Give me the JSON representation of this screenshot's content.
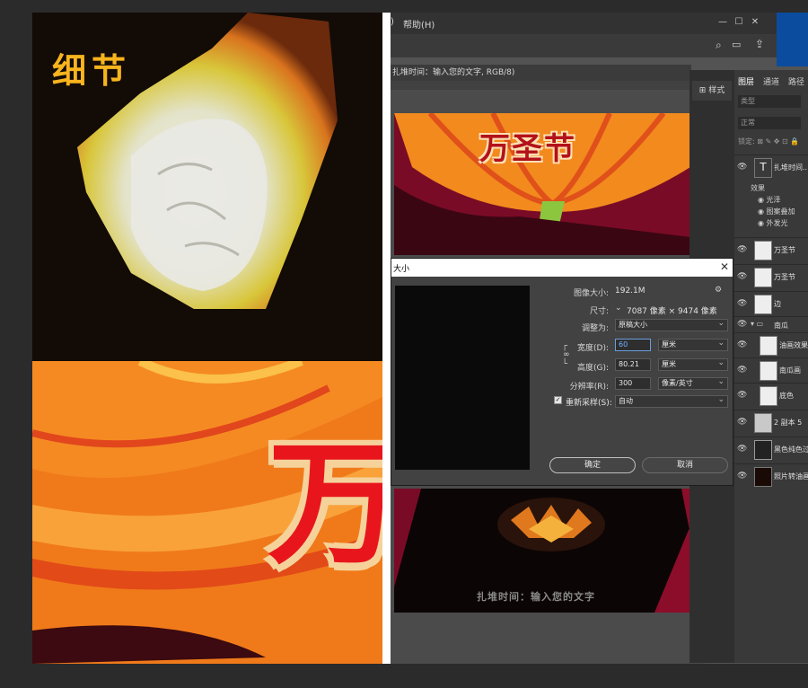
{
  "artwork": {
    "detail_title": "细节",
    "big_character": "万"
  },
  "menubar": {
    "prev_item_fragment": ")",
    "help": "帮助(H)"
  },
  "document": {
    "tab_title": "扎堆时间：输入您的文字, RGB/8)",
    "halloween_title": "万圣节",
    "footer_text": "扎堆时间：输入您的文字"
  },
  "style_panel": {
    "label": "样式"
  },
  "layers_panel": {
    "tabs": [
      "图层",
      "通道",
      "路径"
    ],
    "search_placeholder": "类型",
    "blend_mode": "正常",
    "lock_label": "锁定:",
    "layers": [
      {
        "name": "扎堆时间...",
        "type": "text"
      },
      {
        "name": "万圣节",
        "type": "pixel"
      },
      {
        "name": "万圣节",
        "type": "pixel"
      },
      {
        "name": "边",
        "type": "pixel"
      },
      {
        "name": "南瓜",
        "type": "group"
      },
      {
        "name": "油画效果",
        "type": "pixel"
      },
      {
        "name": "南瓜画",
        "type": "pixel"
      },
      {
        "name": "底色",
        "type": "pixel"
      },
      {
        "name": "2 副本 5",
        "type": "pixel"
      },
      {
        "name": "黑色纯色过滤",
        "type": "pixel"
      },
      {
        "name": "照片转油画效果",
        "type": "pixel"
      }
    ],
    "effects_label": "效果",
    "effects": [
      "光泽",
      "图案叠加",
      "外发光"
    ]
  },
  "dialog": {
    "title": "大小",
    "image_size_label": "图像大小:",
    "image_size_value": "192.1M",
    "dimensions_label": "尺寸:",
    "dimensions_value": "7087 像素 × 9474 像素",
    "fit_label": "调整为:",
    "fit_value": "原稿大小",
    "width_label": "宽度(D):",
    "width_value": "60",
    "width_unit": "厘米",
    "height_label": "高度(G):",
    "height_value": "80.21",
    "height_unit": "厘米",
    "resolution_label": "分辨率(R):",
    "resolution_value": "300",
    "resolution_unit": "像素/英寸",
    "resample_label": "重新采样(S):",
    "resample_checked": true,
    "resample_value": "自动",
    "ok_button": "确定",
    "cancel_button": "取消"
  }
}
